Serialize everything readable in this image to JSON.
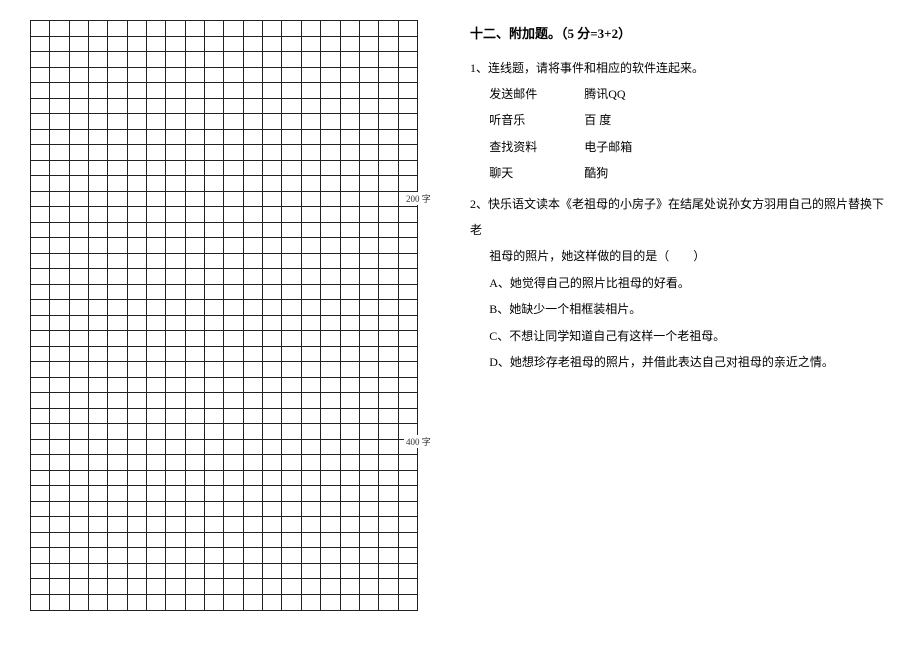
{
  "grid": {
    "cells_per_row": 20,
    "total_rows": 38,
    "label_200": "200 字",
    "label_400": "400 字"
  },
  "right": {
    "section_title": "十二、附加题。（5 分=3+2）",
    "q1": {
      "stem": "1、连线题，请将事件和相应的软件连起来。",
      "pairs": [
        {
          "left": "发送邮件",
          "right": "腾讯QQ"
        },
        {
          "left": "听音乐",
          "right": "百 度"
        },
        {
          "left": "查找资料",
          "right": "电子邮箱"
        },
        {
          "left": "聊天",
          "right": "酷狗"
        }
      ]
    },
    "q2": {
      "stem_line1": "2、快乐语文读本《老祖母的小房子》在结尾处说孙女方羽用自己的照片替换下老",
      "stem_line2": "祖母的照片，她这样做的目的是（　　）",
      "options": {
        "A": "A、她觉得自己的照片比祖母的好看。",
        "B": "B、她缺少一个相框装相片。",
        "C": "C、不想让同学知道自己有这样一个老祖母。",
        "D": "D、她想珍存老祖母的照片，并借此表达自己对祖母的亲近之情。"
      }
    }
  }
}
